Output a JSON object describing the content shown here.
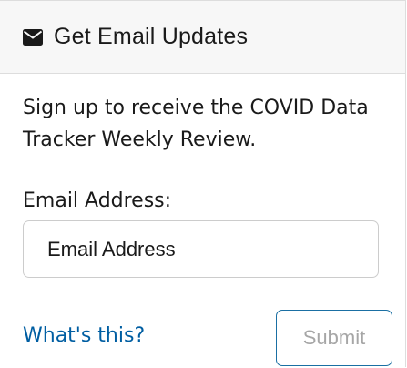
{
  "header": {
    "icon": "envelope-icon",
    "title": "Get Email Updates"
  },
  "description": "Sign up to receive the COVID Data Tracker Weekly Review.",
  "email": {
    "label": "Email Address:",
    "placeholder": "Email Address",
    "value": ""
  },
  "help_link": "What's this?",
  "submit_label": "Submit",
  "colors": {
    "link": "#005ea2",
    "border": "#dddddd",
    "button_border": "#1a6fa3",
    "button_text_disabled": "#a6a6a6"
  }
}
